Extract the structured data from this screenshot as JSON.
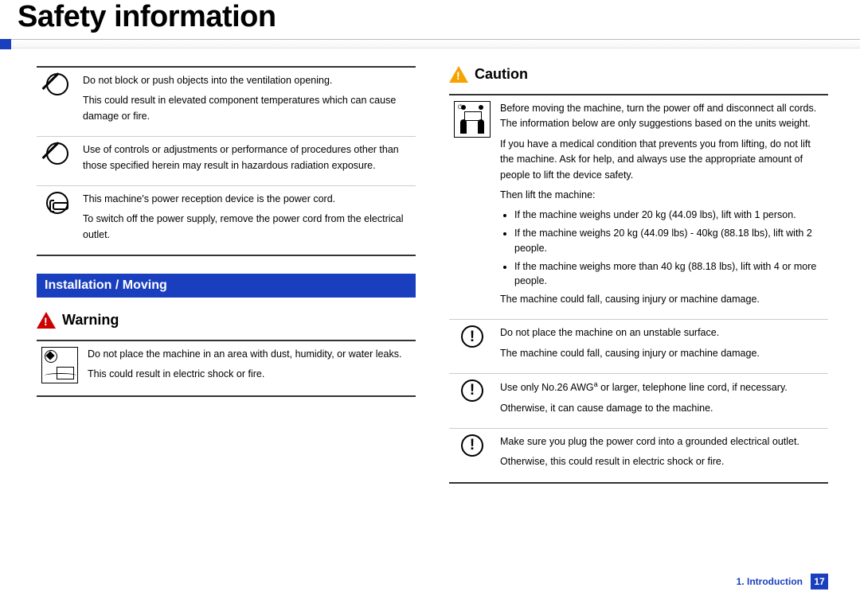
{
  "title": "Safety information",
  "left": {
    "rows": [
      {
        "icon": "prohibit",
        "p1": "Do not block or push objects into the ventilation opening.",
        "p2": "This could result in elevated component temperatures which can cause damage or fire."
      },
      {
        "icon": "prohibit",
        "p1": "Use of controls or adjustments or performance of procedures other than those specified herein may result in hazardous radiation exposure.",
        "p2": ""
      },
      {
        "icon": "plug",
        "p1": "This machine's power reception device is the power cord.",
        "p2": "To switch off the power supply, remove the power cord from the electrical outlet."
      }
    ],
    "section": "Installation / Moving",
    "warning_label": "Warning",
    "warn_rows": [
      {
        "icon": "dust-pictogram",
        "p1": "Do not place the machine in an area with dust, humidity, or water leaks.",
        "p2": "This could result in electric shock or fire."
      }
    ]
  },
  "right": {
    "caution_label": "Caution",
    "rows": [
      {
        "icon": "lift-pictogram",
        "p1": "Before moving the machine, turn the power off and disconnect all cords. The information below are only suggestions based on the units weight.",
        "p2": "If you have a medical condition that prevents you from lifting, do not lift the machine. Ask for help, and always use the appropriate amount of people to lift the device safety.",
        "p3": "Then lift the machine:",
        "bullets": [
          "If the machine weighs under 20 kg (44.09 lbs), lift with 1 person.",
          "If the machine weighs 20 kg (44.09 lbs) - 40kg (88.18 lbs), lift with 2 people.",
          "If the machine weighs more than 40 kg (88.18 lbs), lift with 4 or more people."
        ],
        "p4": "The machine could fall, causing injury or machine damage."
      },
      {
        "icon": "mandatory",
        "p1": "Do not place the machine on an unstable surface.",
        "p2": "The machine could fall, causing injury or machine damage."
      },
      {
        "icon": "mandatory",
        "p1_pre": "Use only No.26 AWG",
        "p1_sup": "a",
        "p1_post": " or larger, telephone line cord, if necessary.",
        "p2": "Otherwise, it can cause damage to the machine."
      },
      {
        "icon": "mandatory",
        "p1": "Make sure you plug the power cord into a grounded electrical outlet.",
        "p2": "Otherwise, this could result in electric shock or fire."
      }
    ]
  },
  "footer": {
    "chapter": "1.  Introduction",
    "page": "17"
  }
}
